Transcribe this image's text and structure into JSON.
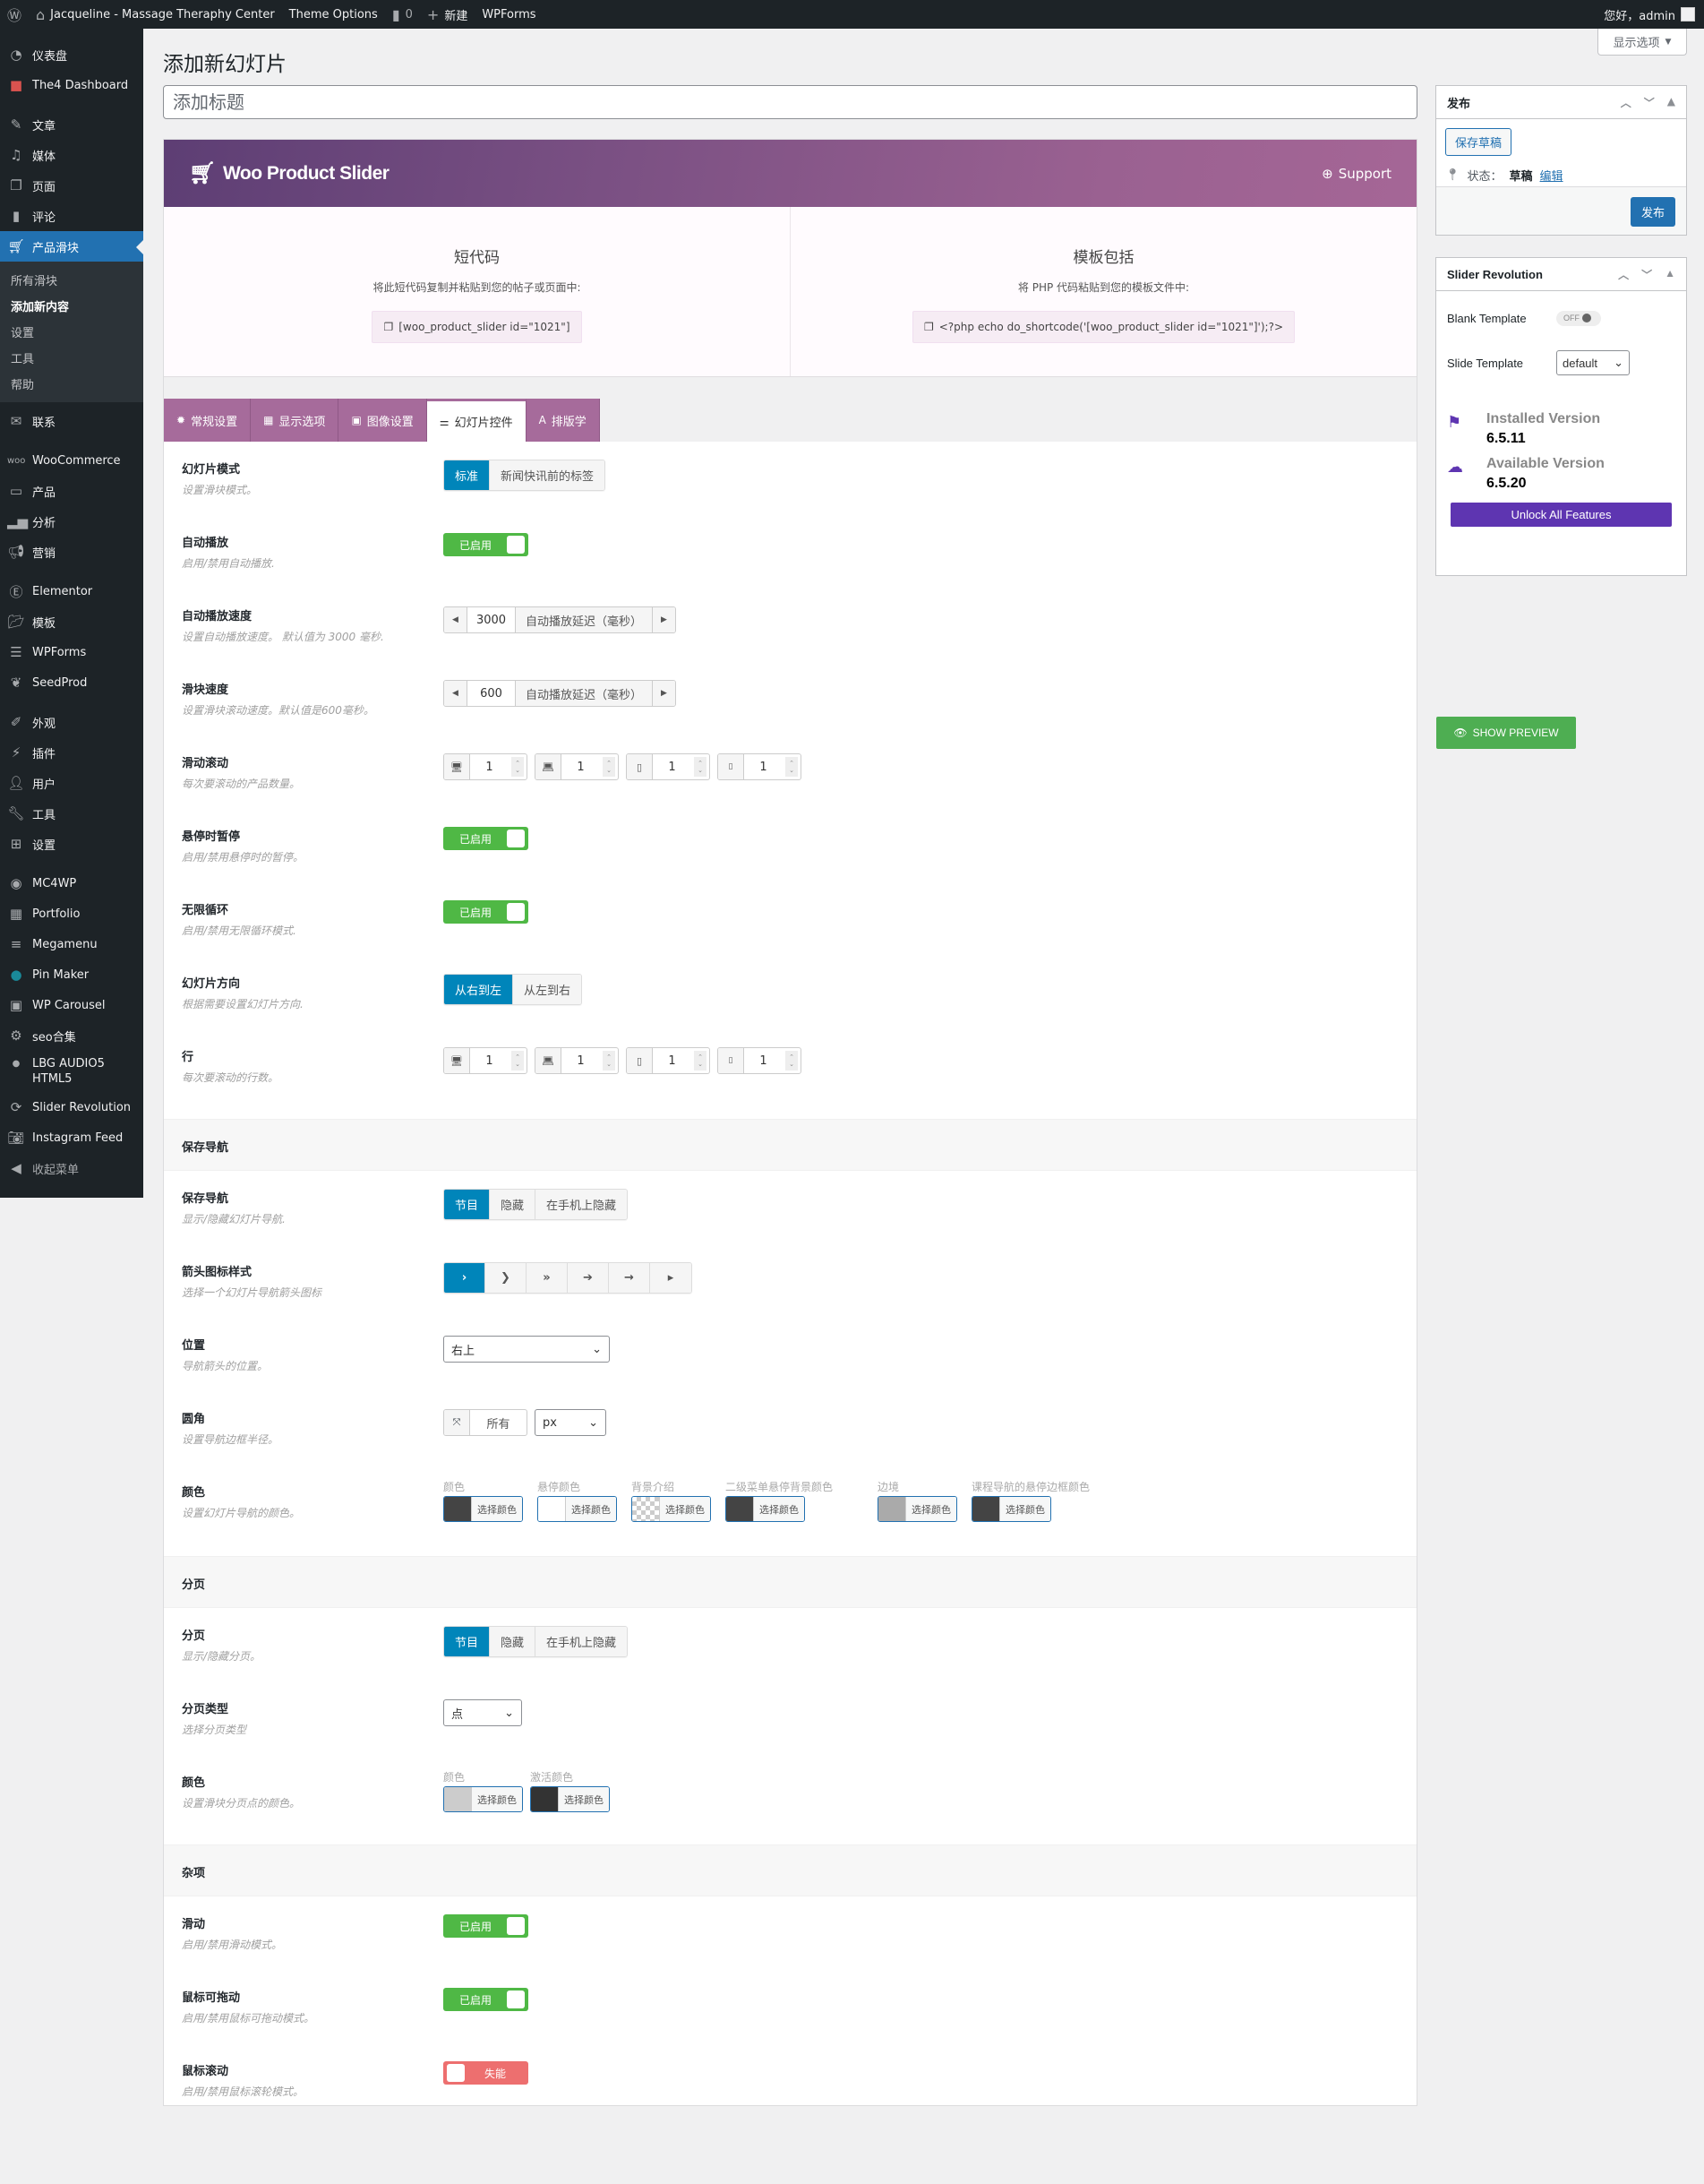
{
  "adminbar": {
    "site_name": "Jacqueline - Massage Theraphy Center",
    "theme_options": "Theme Options",
    "comments_count": "0",
    "new_label": "新建",
    "wpforms": "WPForms",
    "greeting": "您好，admin"
  },
  "sidebar": {
    "items": [
      {
        "label": "仪表盘",
        "icon": "dashboard-icon"
      },
      {
        "label": "The4 Dashboard",
        "icon": "the4-icon"
      },
      {
        "label": "文章",
        "icon": "pin-icon"
      },
      {
        "label": "媒体",
        "icon": "media-icon"
      },
      {
        "label": "页面",
        "icon": "page-icon"
      },
      {
        "label": "评论",
        "icon": "comment-icon"
      },
      {
        "label": "产品滑块",
        "icon": "cart-icon",
        "active": true
      },
      {
        "label": "联系",
        "icon": "mail-icon"
      },
      {
        "label": "WooCommerce",
        "icon": "woo-icon"
      },
      {
        "label": "产品",
        "icon": "archive-icon"
      },
      {
        "label": "分析",
        "icon": "chart-icon"
      },
      {
        "label": "营销",
        "icon": "megaphone-icon"
      },
      {
        "label": "Elementor",
        "icon": "elementor-icon"
      },
      {
        "label": "模板",
        "icon": "folder-icon"
      },
      {
        "label": "WPForms",
        "icon": "form-icon"
      },
      {
        "label": "SeedProd",
        "icon": "seed-icon"
      },
      {
        "label": "外观",
        "icon": "brush-icon"
      },
      {
        "label": "插件",
        "icon": "plugin-icon"
      },
      {
        "label": "用户",
        "icon": "user-icon"
      },
      {
        "label": "工具",
        "icon": "wrench-icon"
      },
      {
        "label": "设置",
        "icon": "settings-icon"
      },
      {
        "label": "MC4WP",
        "icon": "mc4wp-icon"
      },
      {
        "label": "Portfolio",
        "icon": "portfolio-icon"
      },
      {
        "label": "Megamenu",
        "icon": "menu-icon"
      },
      {
        "label": "Pin Maker",
        "icon": "pin-maker-icon"
      },
      {
        "label": "WP Carousel",
        "icon": "carousel-icon"
      },
      {
        "label": "seo合集",
        "icon": "gear-icon"
      },
      {
        "label": "LBG AUDIO5 HTML5",
        "icon": "audio-icon"
      },
      {
        "label": "Slider Revolution",
        "icon": "refresh-icon"
      },
      {
        "label": "Instagram Feed",
        "icon": "camera-icon"
      },
      {
        "label": "收起菜单",
        "icon": "collapse-icon"
      }
    ],
    "submenu": [
      "所有滑块",
      "添加新内容",
      "设置",
      "工具",
      "帮助"
    ]
  },
  "screen_options": "显示选项",
  "page": {
    "title": "添加新幻灯片",
    "title_placeholder": "添加标题"
  },
  "plugin": {
    "name": "Woo Product Slider",
    "support": "Support",
    "shortcode": {
      "title": "短代码",
      "desc": "将此短代码复制并粘贴到您的帖子或页面中:",
      "code": "[woo_product_slider id=\"1021\"]"
    },
    "template": {
      "title": "模板包括",
      "desc": "将 PHP 代码粘贴到您的模板文件中:",
      "code": "<?php echo do_shortcode('[woo_product_slider id=\"1021\"]');?>"
    },
    "tabs": [
      {
        "label": "常规设置",
        "icon": "gear-icon"
      },
      {
        "label": "显示选项",
        "icon": "grid-icon"
      },
      {
        "label": "图像设置",
        "icon": "image-icon"
      },
      {
        "label": "幻灯片控件",
        "icon": "sliders-icon",
        "active": true
      },
      {
        "label": "排版学",
        "icon": "typography-icon"
      }
    ]
  },
  "settings": {
    "slider_mode": {
      "title": "幻灯片模式",
      "desc": "设置滑块模式。",
      "options": [
        "标准",
        "新闻快讯前的标签"
      ],
      "selected": 0
    },
    "autoplay": {
      "title": "自动播放",
      "desc": "启用/禁用自动播放.",
      "state": "已启用"
    },
    "autoplay_speed": {
      "title": "自动播放速度",
      "desc": "设置自动播放速度。 默认值为 3000 毫秒.",
      "value": "3000",
      "unit": "自动播放延迟（毫秒）"
    },
    "slider_speed": {
      "title": "滑块速度",
      "desc": "设置滑块滚动速度。默认值是600毫秒。",
      "value": "600",
      "unit": "自动播放延迟（毫秒）"
    },
    "slide_scroll": {
      "title": "滑动滚动",
      "desc": "每次要滚动的产品数量。",
      "values": [
        "1",
        "1",
        "1",
        "1"
      ]
    },
    "pause_hover": {
      "title": "悬停时暂停",
      "desc": "启用/禁用悬停时的暂停。",
      "state": "已启用"
    },
    "infinite_loop": {
      "title": "无限循环",
      "desc": "启用/禁用无限循环模式.",
      "state": "已启用"
    },
    "direction": {
      "title": "幻灯片方向",
      "desc": "根据需要设置幻灯片方向.",
      "options": [
        "从右到左",
        "从左到右"
      ],
      "selected": 0
    },
    "rows": {
      "title": "行",
      "desc": "每次要滚动的行数。",
      "values": [
        "1",
        "1",
        "1",
        "1"
      ]
    },
    "nav_section": "保存导航",
    "nav": {
      "title": "保存导航",
      "desc": "显示/隐藏幻灯片导航.",
      "options": [
        "节目",
        "隐藏",
        "在手机上隐藏"
      ],
      "selected": 0
    },
    "arrow_style": {
      "title": "箭头图标样式",
      "desc": "选择一个幻灯片导航箭头图标",
      "options": [
        "›",
        "❯",
        "»",
        "➔",
        "→",
        "▸"
      ],
      "selected": 0
    },
    "position": {
      "title": "位置",
      "desc": "导航箭头的位置。",
      "value": "右上"
    },
    "radius": {
      "title": "圆角",
      "desc": "设置导航边框半径。",
      "placeholder": "所有",
      "unit": "px"
    },
    "nav_colors": {
      "title": "颜色",
      "desc": "设置幻灯片导航的颜色。",
      "button_label": "选择颜色",
      "items": [
        {
          "label": "颜色",
          "color": "#444444"
        },
        {
          "label": "悬停颜色",
          "color": "#ffffff"
        },
        {
          "label": "背景介绍",
          "color": "transparent"
        },
        {
          "label": "二级菜单悬停背景颜色",
          "color": "#444444"
        },
        {
          "label": "边境",
          "color": "#aaaaaa"
        },
        {
          "label": "课程导航的悬停边框颜色",
          "color": "#444444"
        }
      ]
    },
    "pagination_section": "分页",
    "pagination": {
      "title": "分页",
      "desc": "显示/隐藏分页。",
      "options": [
        "节目",
        "隐藏",
        "在手机上隐藏"
      ],
      "selected": 0
    },
    "pagination_type": {
      "title": "分页类型",
      "desc": "选择分页类型",
      "value": "点"
    },
    "pagination_colors": {
      "title": "颜色",
      "desc": "设置滑块分页点的颜色。",
      "button_label": "选择颜色",
      "items": [
        {
          "label": "颜色",
          "color": "#cccccc"
        },
        {
          "label": "激活颜色",
          "color": "#333333"
        }
      ]
    },
    "misc_section": "杂项",
    "swipe": {
      "title": "滑动",
      "desc": "启用/禁用滑动模式。",
      "state": "已启用"
    },
    "mouse_drag": {
      "title": "鼠标可拖动",
      "desc": "启用/禁用鼠标可拖动模式。",
      "state": "已启用"
    },
    "mouse_wheel": {
      "title": "鼠标滚动",
      "desc": "启用/禁用鼠标滚轮模式。",
      "state": "失能"
    }
  },
  "publish": {
    "title": "发布",
    "save_draft": "保存草稿",
    "status_label": "状态：",
    "status_value": "草稿",
    "edit": "编辑",
    "publish_btn": "发布"
  },
  "slider_revolution": {
    "title": "Slider Revolution",
    "blank_template": "Blank Template",
    "blank_state": "OFF",
    "slide_template": "Slide Template",
    "slide_template_value": "default",
    "installed_label": "Installed Version",
    "installed_value": "6.5.11",
    "available_label": "Available Version",
    "available_value": "6.5.20",
    "unlock": "Unlock All Features"
  },
  "show_preview": "SHOW PREVIEW",
  "colors": {
    "accent": "#0085ba",
    "wp_blue": "#2271b1",
    "toggle_on": "#4fb845",
    "toggle_off": "#ed6f6f",
    "tab_purple": "#a66b9b",
    "revslider_purple": "#5e35b1"
  }
}
